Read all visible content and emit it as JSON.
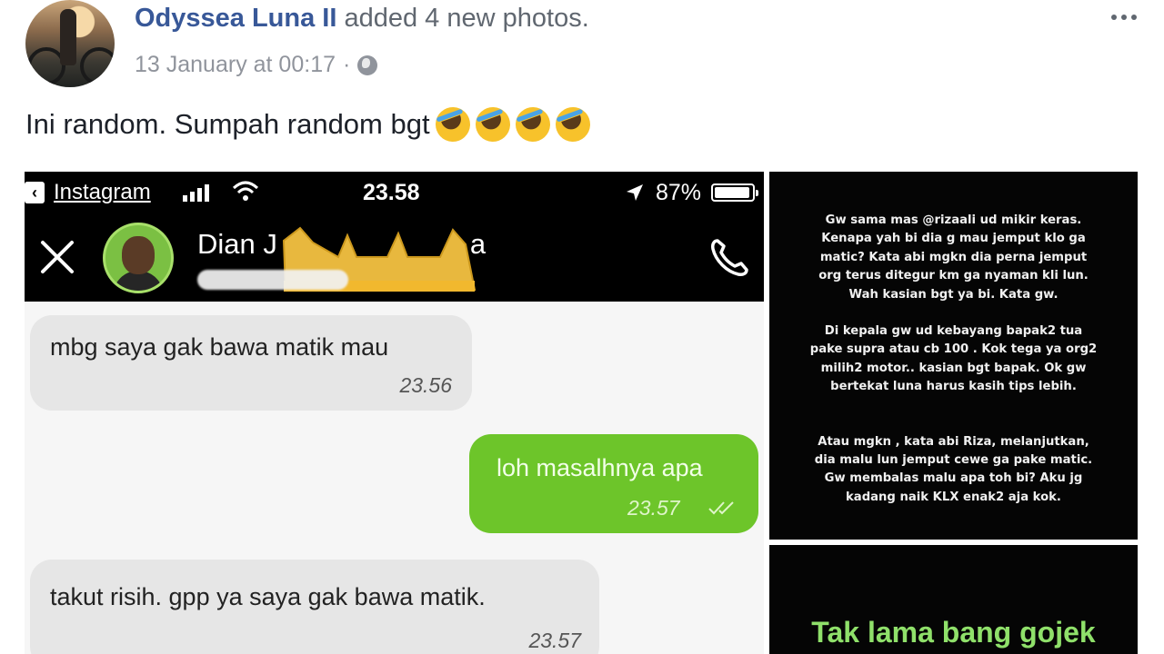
{
  "post": {
    "author": "Odyssea Luna II",
    "action": "added 4 new photos.",
    "timestamp": "13 January at 00:17",
    "separator": "·",
    "privacy_icon": "globe-icon",
    "caption": "Ini random. Sumpah random bgt",
    "caption_emoji_icon": "rolling-on-floor-laughing-icon",
    "caption_emoji_count": 4,
    "menu_icon": "more-options-icon"
  },
  "dm": {
    "status_bar": {
      "back_app": "Instagram",
      "time": "23.58",
      "battery": "87%"
    },
    "header": {
      "contact_name": "Dian J",
      "contact_name_tail": "a",
      "close_icon": "close-icon",
      "call_icon": "phone-icon"
    },
    "messages": [
      {
        "direction": "incoming",
        "text": "mbg saya gak bawa matik mau",
        "time": "23.56"
      },
      {
        "direction": "outgoing",
        "text": "loh masalhnya apa",
        "time": "23.57"
      },
      {
        "direction": "incoming",
        "text": "takut risih.  gpp ya saya gak bawa matik.",
        "time": "23.57"
      }
    ]
  },
  "story": {
    "paragraphs": [
      [
        "Gw sama mas @rizaali ud mikir keras.",
        "Kenapa yah bi dia g mau jemput klo ga",
        "matic? Kata abi  mgkn dia perna jemput",
        "org terus ditegur km ga nyaman kli lun.",
        "Wah kasian bgt ya bi.  Kata gw."
      ],
      [
        "Di kepala gw ud kebayang bapak2 tua",
        "pake supra atau cb 100 . Kok tega ya org2",
        "milih2 motor.. kasian bgt bapak. Ok gw",
        "bertekat luna harus kasih tips lebih."
      ],
      [
        "Atau mgkn , kata abi Riza, melanjutkan,",
        "dia malu lun jemput cewe ga pake matic.",
        "Gw membalas malu apa toh bi? Aku jg",
        "kadang naik KLX enak2 aja kok."
      ]
    ],
    "headline": "Tak lama bang gojek"
  },
  "colors": {
    "link_blue": "#385898",
    "meta_gray": "#90949c",
    "bubble_out": "#6dc52a",
    "bubble_in": "#e6e6e6",
    "crown_gold": "#f5c242",
    "story_green": "#8fe06a"
  }
}
